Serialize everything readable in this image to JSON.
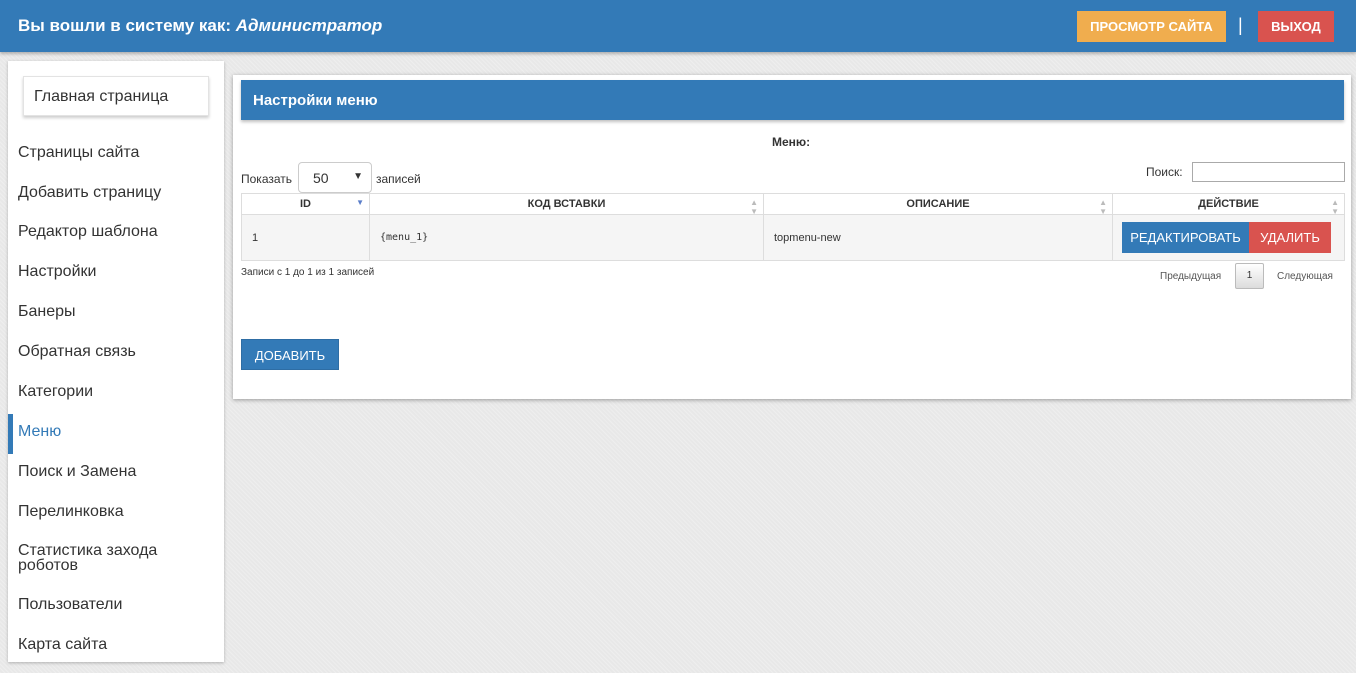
{
  "header": {
    "login_prefix": "Вы вошли в систему как:",
    "login_role": "Администратор",
    "view_site_label": "ПРОСМОТР САЙТА",
    "separator": "|",
    "logout_label": "ВЫХОД"
  },
  "sidebar": {
    "home_label": "Главная страница",
    "items": [
      {
        "label": "Страницы сайта"
      },
      {
        "label": "Добавить страницу"
      },
      {
        "label": "Редактор шаблона"
      },
      {
        "label": "Настройки"
      },
      {
        "label": "Банеры"
      },
      {
        "label": "Обратная связь"
      },
      {
        "label": "Категории"
      },
      {
        "label": "Меню",
        "active": true
      },
      {
        "label": "Поиск и Замена"
      },
      {
        "label": "Перелинковка"
      },
      {
        "label": "Статистика захода роботов"
      },
      {
        "label": "Пользователи"
      },
      {
        "label": "Карта сайта"
      }
    ]
  },
  "panel": {
    "title": "Настройки меню",
    "caption": "Меню:",
    "show_label": "Показать",
    "page_size": "50",
    "entries_label": "записей",
    "search_label": "Поиск:",
    "search_value": "",
    "columns": [
      "ID",
      "КОД ВСТАВКИ",
      "ОПИСАНИЕ",
      "ДЕЙСТВИЕ"
    ],
    "rows": [
      {
        "id": "1",
        "code": "{menu_1}",
        "description": "topmenu-new"
      }
    ],
    "edit_label": "РЕДАКТИРОВАТЬ",
    "delete_label": "УДАЛИТЬ",
    "info": "Записи с 1 до 1 из 1 записей",
    "prev_label": "Предыдущая",
    "current_page": "1",
    "next_label": "Следующая",
    "add_label": "ДОБАВИТЬ"
  },
  "colors": {
    "primary": "#337ab7",
    "warning": "#f0ad4e",
    "danger": "#d9534f"
  }
}
